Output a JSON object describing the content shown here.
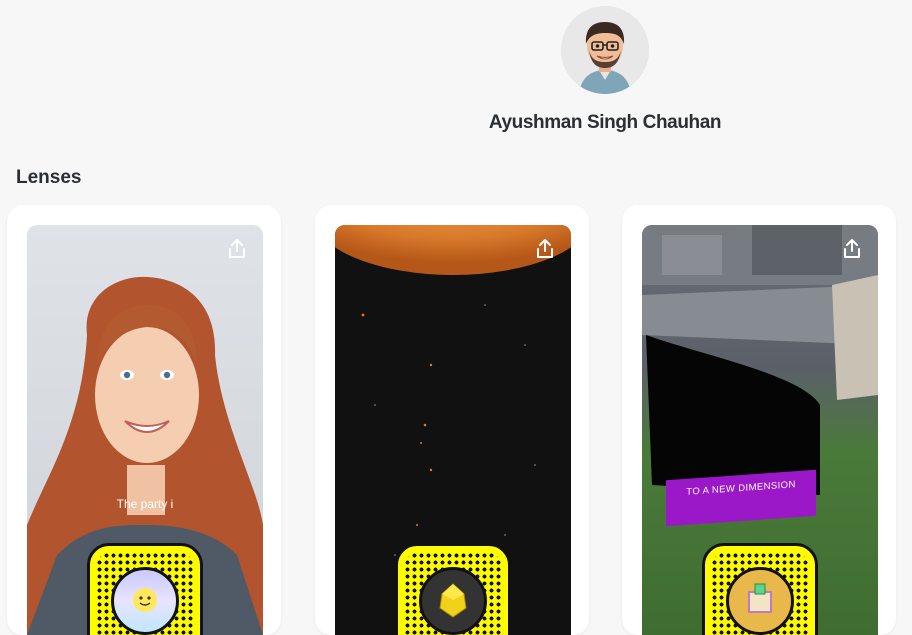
{
  "profile": {
    "name": "Ayushman Singh Chauhan",
    "avatar_icon": "bitmoji-avatar"
  },
  "section": {
    "title": "Lenses"
  },
  "lenses": [
    {
      "caption": "The party i",
      "share_icon": "share-icon",
      "code_icon": "snapcode"
    },
    {
      "caption": "",
      "share_icon": "share-icon",
      "code_icon": "snapcode"
    },
    {
      "banner": "TO A NEW DIMENSION",
      "share_icon": "share-icon",
      "code_icon": "snapcode"
    }
  ],
  "colors": {
    "snapcode": "#fffc00",
    "banner": "#9a18c8",
    "background": "#f7f7f7"
  }
}
